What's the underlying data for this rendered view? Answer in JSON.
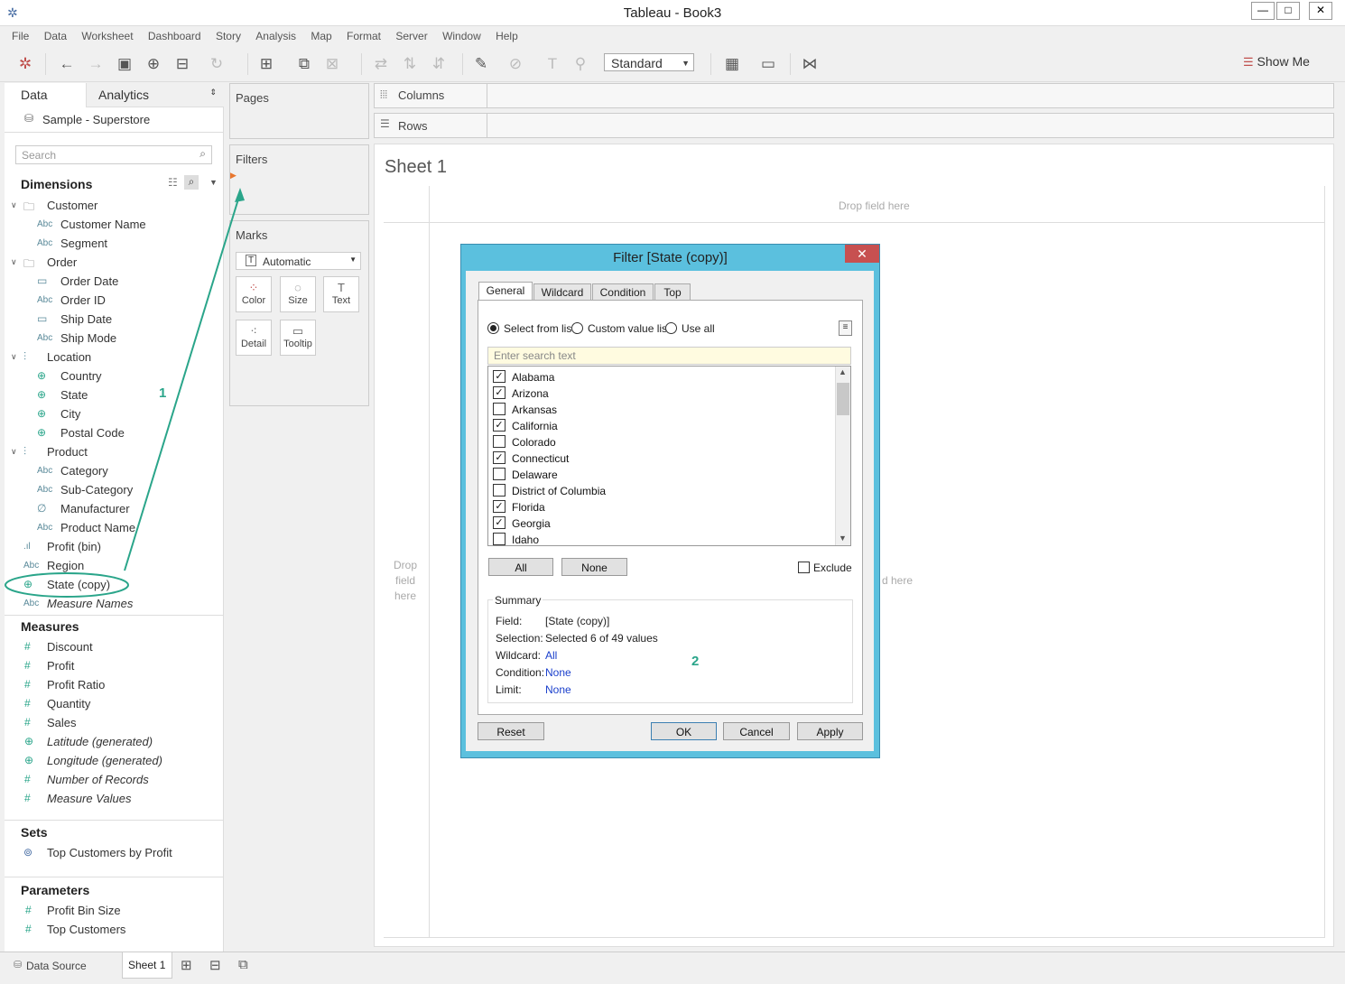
{
  "window": {
    "title": "Tableau - Book3",
    "controls": {
      "minimize": "—",
      "maximize": "□",
      "close": "✕"
    }
  },
  "menu": [
    "File",
    "Data",
    "Worksheet",
    "Dashboard",
    "Story",
    "Analysis",
    "Map",
    "Format",
    "Server",
    "Window",
    "Help"
  ],
  "toolbar": {
    "fit_select": "Standard",
    "show_me": "Show Me"
  },
  "data_pane": {
    "tabs": {
      "data": "Data",
      "analytics": "Analytics"
    },
    "datasource": "Sample - Superstore",
    "search_placeholder": "Search",
    "dimensions_header": "Dimensions",
    "dimensions": [
      {
        "label": "Customer",
        "type": "folder"
      },
      {
        "label": "Customer Name",
        "type": "Abc"
      },
      {
        "label": "Segment",
        "type": "Abc"
      },
      {
        "label": "Order",
        "type": "folder"
      },
      {
        "label": "Order Date",
        "type": "date"
      },
      {
        "label": "Order ID",
        "type": "Abc"
      },
      {
        "label": "Ship Date",
        "type": "date"
      },
      {
        "label": "Ship Mode",
        "type": "Abc"
      },
      {
        "label": "Location",
        "type": "hierarchy"
      },
      {
        "label": "Country",
        "type": "geo"
      },
      {
        "label": "State",
        "type": "geo"
      },
      {
        "label": "City",
        "type": "geo"
      },
      {
        "label": "Postal Code",
        "type": "geo"
      },
      {
        "label": "Product",
        "type": "hierarchy"
      },
      {
        "label": "Category",
        "type": "Abc"
      },
      {
        "label": "Sub-Category",
        "type": "Abc"
      },
      {
        "label": "Manufacturer",
        "type": "clip"
      },
      {
        "label": "Product Name",
        "type": "Abc"
      },
      {
        "label": "Profit (bin)",
        "type": "bin"
      },
      {
        "label": "Region",
        "type": "Abc"
      },
      {
        "label": "State (copy)",
        "type": "geo"
      },
      {
        "label": "Measure Names",
        "type": "Abc"
      }
    ],
    "measures_header": "Measures",
    "measures": [
      "Discount",
      "Profit",
      "Profit Ratio",
      "Quantity",
      "Sales",
      "Latitude (generated)",
      "Longitude (generated)",
      "Number of Records",
      "Measure Values"
    ],
    "sets_header": "Sets",
    "sets": [
      "Top Customers by Profit"
    ],
    "parameters_header": "Parameters",
    "parameters": [
      "Profit Bin Size",
      "Top Customers"
    ]
  },
  "shelves": {
    "pages": "Pages",
    "filters": "Filters",
    "marks": "Marks",
    "marks_type": "Automatic",
    "mark_buttons": [
      "Color",
      "Size",
      "Text",
      "Detail",
      "Tooltip"
    ],
    "columns": "Columns",
    "rows": "Rows"
  },
  "sheet": {
    "title": "Sheet 1",
    "drop_top": "Drop field here",
    "drop_left_1": "Drop",
    "drop_left_2": "field",
    "drop_left_3": "here",
    "drop_right": "d here"
  },
  "dialog": {
    "title": "Filter [State (copy)]",
    "tabs": [
      "General",
      "Wildcard",
      "Condition",
      "Top"
    ],
    "radio": [
      "Select from list",
      "Custom value list",
      "Use all"
    ],
    "search_placeholder": "Enter search text",
    "states": [
      {
        "name": "Alabama",
        "checked": true
      },
      {
        "name": "Arizona",
        "checked": true
      },
      {
        "name": "Arkansas",
        "checked": false
      },
      {
        "name": "California",
        "checked": true
      },
      {
        "name": "Colorado",
        "checked": false
      },
      {
        "name": "Connecticut",
        "checked": true
      },
      {
        "name": "Delaware",
        "checked": false
      },
      {
        "name": "District of Columbia",
        "checked": false
      },
      {
        "name": "Florida",
        "checked": true
      },
      {
        "name": "Georgia",
        "checked": true
      },
      {
        "name": "Idaho",
        "checked": false
      }
    ],
    "btn_all": "All",
    "btn_none": "None",
    "exclude": "Exclude",
    "summary_title": "Summary",
    "summary": {
      "field_label": "Field:",
      "field": "[State (copy)]",
      "selection_label": "Selection:",
      "selection": "Selected 6 of 49 values",
      "wildcard_label": "Wildcard:",
      "wildcard": "All",
      "condition_label": "Condition:",
      "condition": "None",
      "limit_label": "Limit:",
      "limit": "None"
    },
    "reset": "Reset",
    "ok": "OK",
    "cancel": "Cancel",
    "apply": "Apply"
  },
  "annotations": {
    "one": "1",
    "two": "2"
  },
  "bottom_tabs": {
    "datasource": "Data Source",
    "sheet1": "Sheet 1"
  },
  "colors": {
    "dialog_title_bg": "#5bc0de",
    "annotation": "#2aa58a",
    "close_bg": "#c75050",
    "link_blue": "#1a3fcc"
  }
}
